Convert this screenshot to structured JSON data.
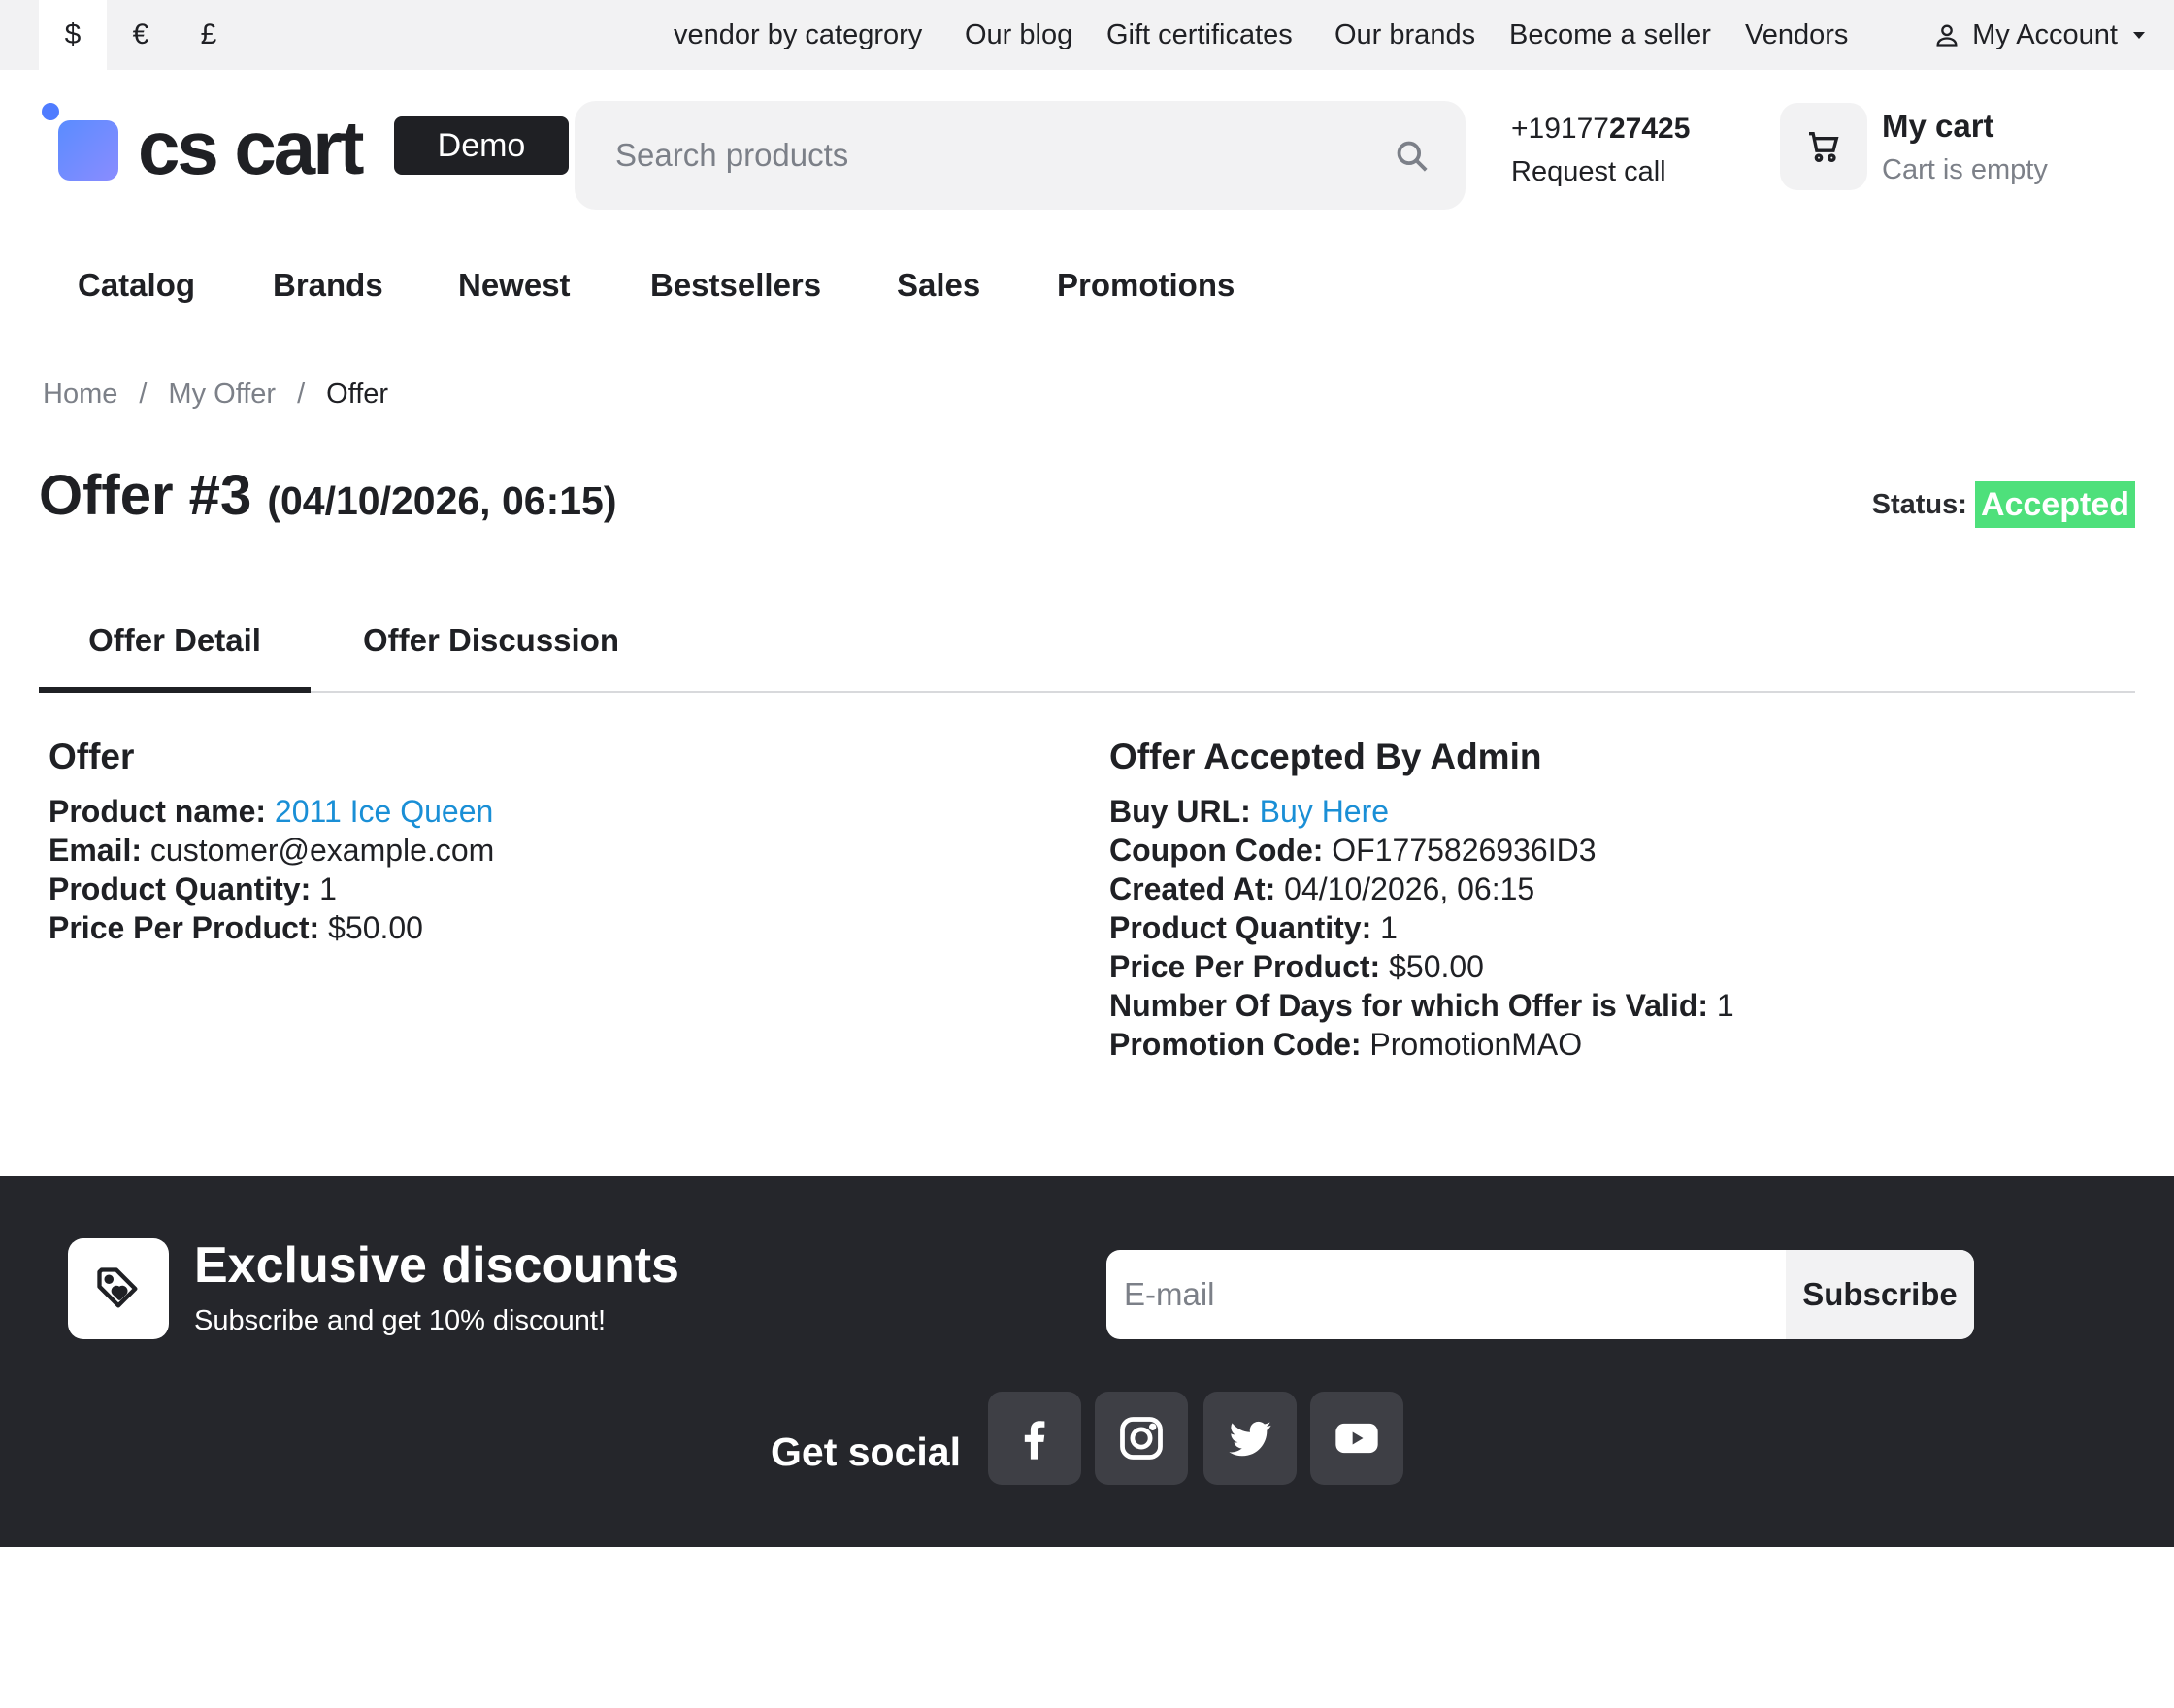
{
  "topbar": {
    "currencies": [
      "$",
      "€",
      "£"
    ],
    "links": [
      "vendor by categrory",
      "Our blog",
      "Gift certificates",
      "Our brands",
      "Become a seller",
      "Vendors"
    ],
    "account": "My Account"
  },
  "header": {
    "logo_text": "cs cart",
    "logo_badge": "Demo",
    "search_placeholder": "Search products",
    "phone_prefix": "+19177",
    "phone_bold": "27425",
    "request_call": "Request call",
    "cart_title": "My cart",
    "cart_status": "Cart is empty"
  },
  "nav": [
    "Catalog",
    "Brands",
    "Newest",
    "Bestsellers",
    "Sales",
    "Promotions"
  ],
  "breadcrumb": {
    "items": [
      "Home",
      "My Offer",
      "Offer"
    ],
    "separator": "/"
  },
  "offer": {
    "title": "Offer #3",
    "date": "(04/10/2026, 06:15)",
    "status_label": "Status:",
    "status": "Accepted",
    "status_color": "#4ee07b"
  },
  "tabs": [
    "Offer Detail",
    "Offer Discussion"
  ],
  "left": {
    "heading": "Offer",
    "product_label": "Product name:",
    "product_value": "2011 Ice Queen",
    "email_label": "Email:",
    "email_value": "customer@example.com",
    "qty_label": "Product Quantity:",
    "qty_value": "1",
    "price_label": "Price Per Product:",
    "price_value": "$50.00"
  },
  "right": {
    "heading": "Offer Accepted By Admin",
    "buy_label": "Buy URL:",
    "buy_value": "Buy Here",
    "coupon_label": "Coupon Code:",
    "coupon_value": "OF1775826936ID3",
    "created_label": "Created At:",
    "created_value": "04/10/2026, 06:15",
    "qty_label": "Product Quantity:",
    "qty_value": "1",
    "price_label": "Price Per Product:",
    "price_value": "$50.00",
    "days_label": "Number Of Days for which Offer is Valid:",
    "days_value": "1",
    "promo_label": "Promotion Code:",
    "promo_value": "PromotionMAO"
  },
  "footer": {
    "discount_title": "Exclusive discounts",
    "discount_sub": "Subscribe and get 10% discount!",
    "email_placeholder": "E-mail",
    "subscribe": "Subscribe",
    "social_label": "Get social",
    "social_icons": [
      "facebook-icon",
      "instagram-icon",
      "twitter-icon",
      "youtube-icon"
    ]
  },
  "colors": {
    "link": "#1a8fd6",
    "footer_bg": "#25262b",
    "accepted": "#4ee07b"
  }
}
